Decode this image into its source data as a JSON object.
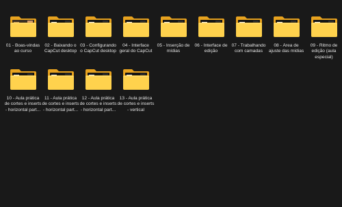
{
  "folders": [
    {
      "name": "01 - Boas-vindas ao curso",
      "thumb": "intro"
    },
    {
      "name": "02 - Baixando o CapCut desktop",
      "thumb": "capcut"
    },
    {
      "name": "03 - Configurando o CapCut desktop",
      "thumb": "capcut"
    },
    {
      "name": "04 - Interface geral do CapCut",
      "thumb": "capcut"
    },
    {
      "name": "05 - Inserção de mídias",
      "thumb": "capcut"
    },
    {
      "name": "06 - Interface de edição",
      "thumb": "capcut"
    },
    {
      "name": "07 - Trabalhando com camadas",
      "thumb": "capcut"
    },
    {
      "name": "08 - Área de ajuste das mídias",
      "thumb": "capcut"
    },
    {
      "name": "09 - Ritmo de edição (aula especial)",
      "thumb": "capcut"
    },
    {
      "name": "10 - Aula prática de cortes e inserts - horizontal part...",
      "thumb": "capcut"
    },
    {
      "name": "11 - Aula prática de cortes e inserts - horizontal part...",
      "thumb": "capcut"
    },
    {
      "name": "12 - Aula prática de cortes e inserts - horizontal part...",
      "thumb": "capcut"
    },
    {
      "name": "13 - Aula prática de cortes e inserts - vertical",
      "thumb": "capcut"
    }
  ],
  "colors": {
    "background": "#191919",
    "folder_back": "#e8a31f",
    "folder_front": "#ffd24d",
    "thumb_dark": "#141414",
    "thumb_accent": "#e23a3a",
    "label_text": "#e6e6e6"
  },
  "icons": {
    "folder": "folder-icon"
  }
}
